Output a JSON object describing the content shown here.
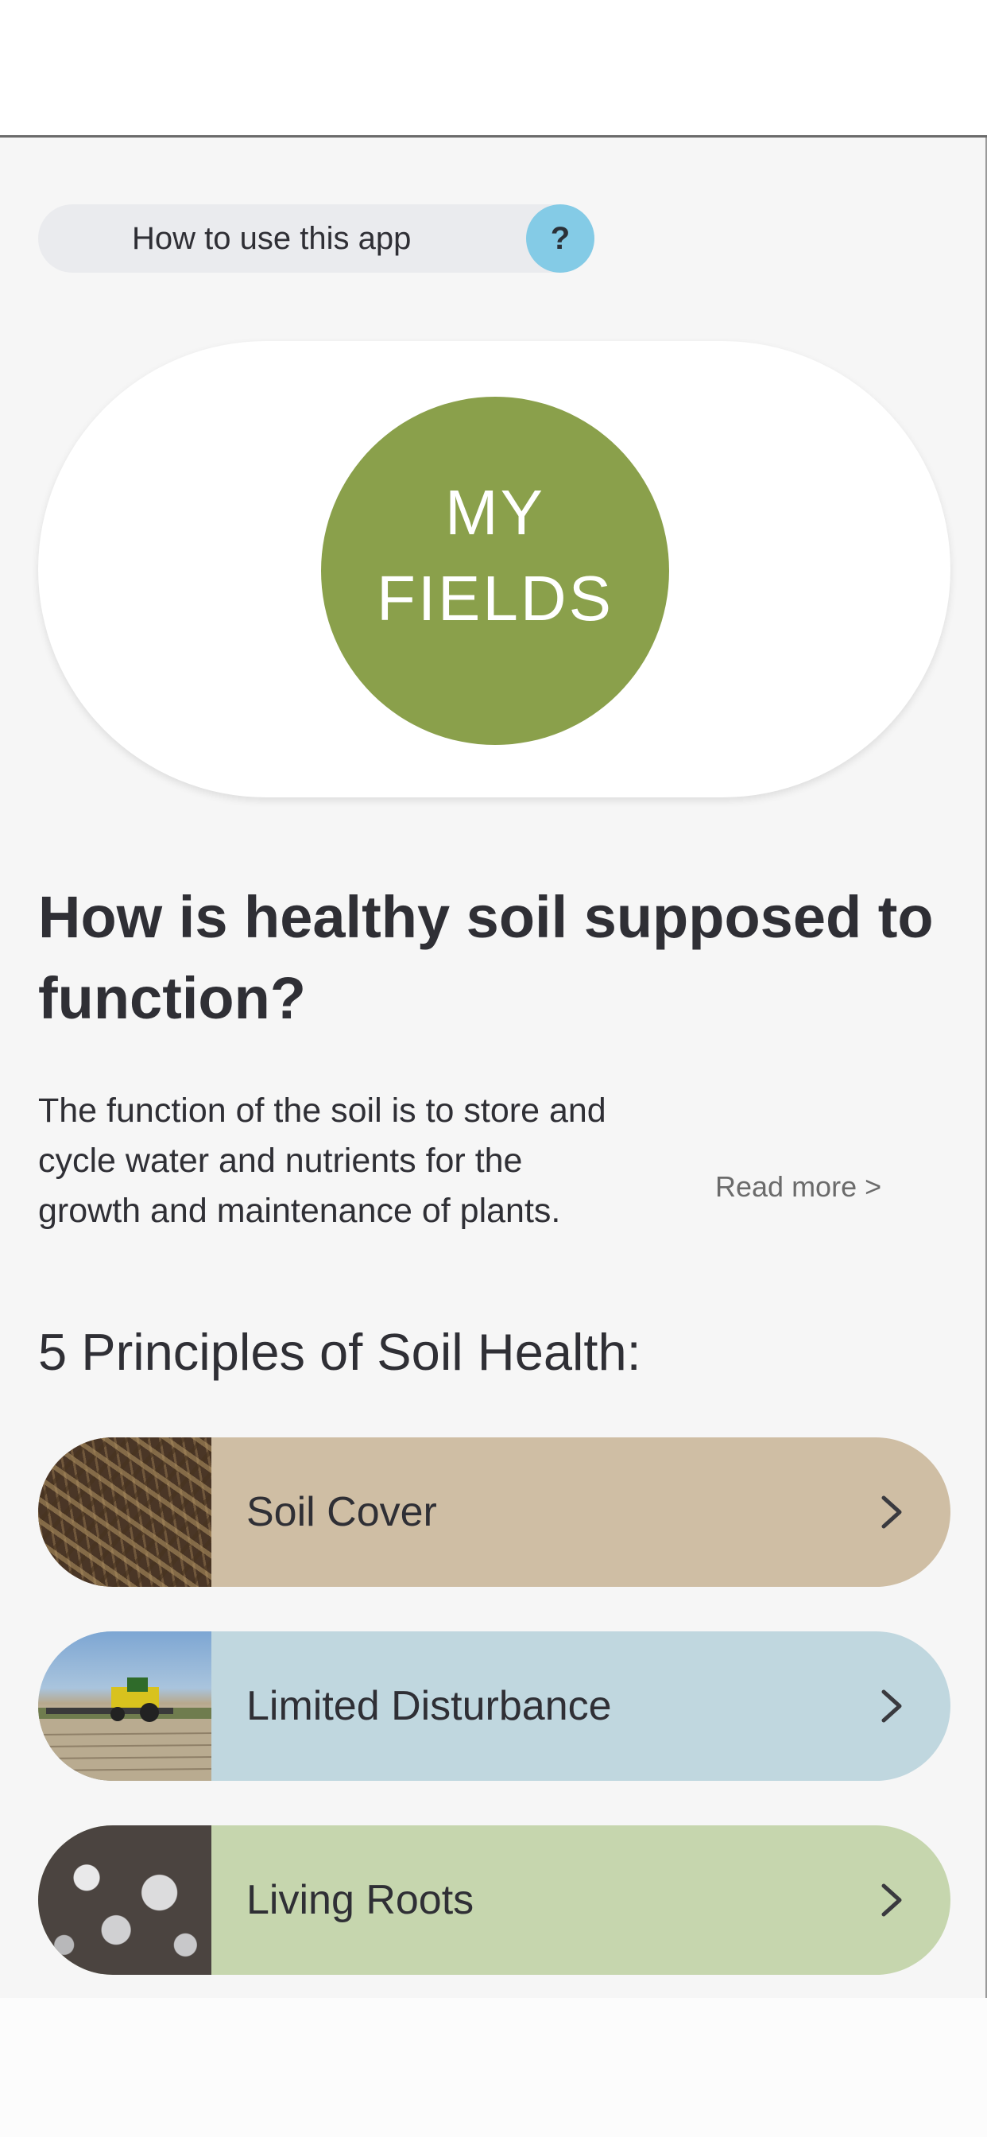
{
  "help": {
    "label": "How to use this app",
    "icon_text": "?"
  },
  "my_fields": {
    "line1": "MY",
    "line2": "FIELDS"
  },
  "soil_section": {
    "title": "How is healthy soil supposed to function?",
    "description": "The function of the soil is to store and cycle water and nutrients for the growth and maintenance of plants.",
    "read_more": "Read more >"
  },
  "principles": {
    "title": "5 Principles of Soil Health:",
    "items": [
      {
        "label": "Soil Cover",
        "icon": "soil-cover-photo",
        "color": "#cfbea4"
      },
      {
        "label": "Limited Disturbance",
        "icon": "tractor-field-photo",
        "color": "#c0d7df"
      },
      {
        "label": "Living Roots",
        "icon": "frosted-roots-photo",
        "color": "#c6d6ae"
      }
    ]
  },
  "colors": {
    "accent_green": "#8aa04b",
    "help_blue": "#84cbe6",
    "background": "#f6f6f6"
  }
}
